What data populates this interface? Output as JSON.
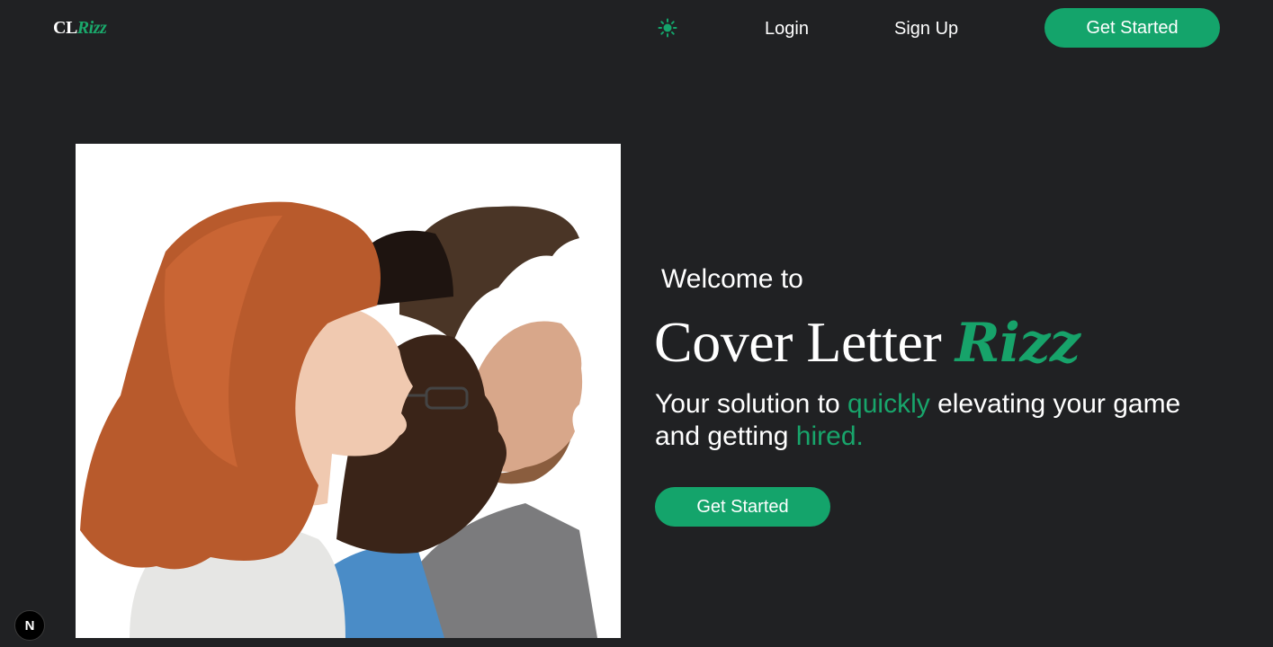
{
  "nav": {
    "logo_prefix": "CL",
    "logo_suffix": "Rizz",
    "theme_icon": "sun-icon",
    "login_label": "Login",
    "signup_label": "Sign Up",
    "cta_label": "Get Started"
  },
  "hero": {
    "image_icon": "three-profiles-photo",
    "welcome": "Welcome to",
    "headline_main": "Cover Letter ",
    "headline_accent": "Rizz",
    "tagline_part1": "Your solution to ",
    "tagline_highlight1": "quickly",
    "tagline_part2": " elevating your game and getting ",
    "tagline_highlight2": "hired.",
    "cta_label": "Get Started"
  },
  "badge": {
    "label": "N"
  },
  "colors": {
    "background": "#202123",
    "accent": "#14a46b",
    "text": "#ffffff"
  }
}
